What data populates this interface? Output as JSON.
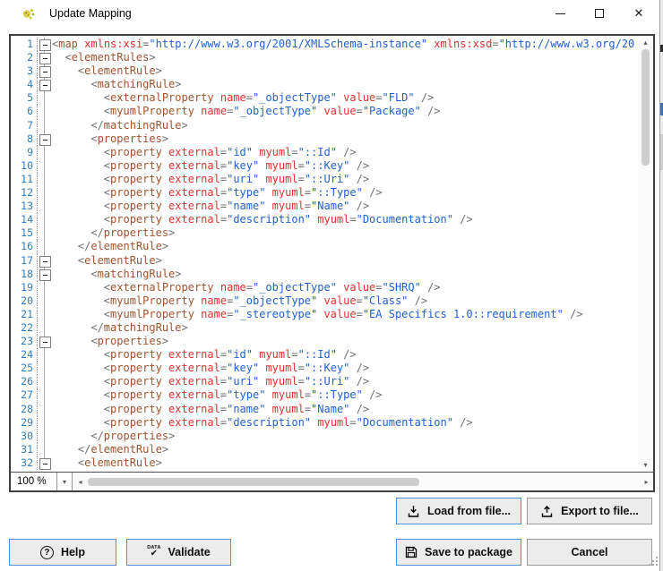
{
  "window": {
    "title": "Update Mapping"
  },
  "icons": {
    "help_glyph": "?",
    "validate_text": "DATA",
    "validate_check": "✔",
    "close_glyph": "✕",
    "dropdown_arrow": "▾",
    "scroll_up": "▴",
    "scroll_down": "▾",
    "scroll_left": "◂",
    "scroll_right": "▸"
  },
  "editor": {
    "zoom_level": "100 %",
    "lines": [
      {
        "n": 1,
        "f": 1,
        "s": [
          [
            "d",
            "<"
          ],
          [
            "t",
            "map"
          ],
          [
            "a",
            " xmlns:xsi"
          ],
          [
            "d",
            "="
          ],
          [
            "v",
            "\"http://www.w3.org/2001/XMLSchema-instance\""
          ],
          [
            "a",
            " xmlns:xsd"
          ],
          [
            "d",
            "="
          ],
          [
            "v",
            "\"http://www.w3.org/20"
          ]
        ]
      },
      {
        "n": 2,
        "f": 1,
        "s": [
          [
            "d",
            "  <"
          ],
          [
            "t",
            "elementRules"
          ],
          [
            "d",
            ">"
          ]
        ]
      },
      {
        "n": 3,
        "f": 1,
        "s": [
          [
            "d",
            "    <"
          ],
          [
            "t",
            "elementRule"
          ],
          [
            "d",
            ">"
          ]
        ]
      },
      {
        "n": 4,
        "f": 1,
        "s": [
          [
            "d",
            "      <"
          ],
          [
            "t",
            "matchingRule"
          ],
          [
            "d",
            ">"
          ]
        ]
      },
      {
        "n": 5,
        "f": 0,
        "s": [
          [
            "d",
            "        <"
          ],
          [
            "t",
            "externalProperty"
          ],
          [
            "a",
            " name"
          ],
          [
            "d",
            "="
          ],
          [
            "v",
            "\"_objectType\""
          ],
          [
            "a",
            " value"
          ],
          [
            "d",
            "="
          ],
          [
            "v",
            "\"FLD\""
          ],
          [
            "d",
            " />"
          ]
        ]
      },
      {
        "n": 6,
        "f": 0,
        "s": [
          [
            "d",
            "        <"
          ],
          [
            "t",
            "myumlProperty"
          ],
          [
            "a",
            " name"
          ],
          [
            "d",
            "="
          ],
          [
            "v",
            "\"_objectType\""
          ],
          [
            "a",
            " value"
          ],
          [
            "d",
            "="
          ],
          [
            "v",
            "\"Package\""
          ],
          [
            "d",
            " />"
          ]
        ]
      },
      {
        "n": 7,
        "f": 0,
        "s": [
          [
            "d",
            "      </"
          ],
          [
            "t",
            "matchingRule"
          ],
          [
            "d",
            ">"
          ]
        ]
      },
      {
        "n": 8,
        "f": 1,
        "s": [
          [
            "d",
            "      <"
          ],
          [
            "t",
            "properties"
          ],
          [
            "d",
            ">"
          ]
        ]
      },
      {
        "n": 9,
        "f": 0,
        "s": [
          [
            "d",
            "        <"
          ],
          [
            "t",
            "property"
          ],
          [
            "a",
            " external"
          ],
          [
            "d",
            "="
          ],
          [
            "v",
            "\"id\""
          ],
          [
            "a",
            " myuml"
          ],
          [
            "d",
            "="
          ],
          [
            "v",
            "\"::Id\""
          ],
          [
            "d",
            " />"
          ]
        ]
      },
      {
        "n": 10,
        "f": 0,
        "s": [
          [
            "d",
            "        <"
          ],
          [
            "t",
            "property"
          ],
          [
            "a",
            " external"
          ],
          [
            "d",
            "="
          ],
          [
            "v",
            "\"key\""
          ],
          [
            "a",
            " myuml"
          ],
          [
            "d",
            "="
          ],
          [
            "v",
            "\"::Key\""
          ],
          [
            "d",
            " />"
          ]
        ]
      },
      {
        "n": 11,
        "f": 0,
        "s": [
          [
            "d",
            "        <"
          ],
          [
            "t",
            "property"
          ],
          [
            "a",
            " external"
          ],
          [
            "d",
            "="
          ],
          [
            "v",
            "\"uri\""
          ],
          [
            "a",
            " myuml"
          ],
          [
            "d",
            "="
          ],
          [
            "v",
            "\"::Uri\""
          ],
          [
            "d",
            " />"
          ]
        ]
      },
      {
        "n": 12,
        "f": 0,
        "s": [
          [
            "d",
            "        <"
          ],
          [
            "t",
            "property"
          ],
          [
            "a",
            " external"
          ],
          [
            "d",
            "="
          ],
          [
            "v",
            "\"type\""
          ],
          [
            "a",
            " myuml"
          ],
          [
            "d",
            "="
          ],
          [
            "v",
            "\"::Type\""
          ],
          [
            "d",
            " />"
          ]
        ]
      },
      {
        "n": 13,
        "f": 0,
        "s": [
          [
            "d",
            "        <"
          ],
          [
            "t",
            "property"
          ],
          [
            "a",
            " external"
          ],
          [
            "d",
            "="
          ],
          [
            "v",
            "\"name\""
          ],
          [
            "a",
            " myuml"
          ],
          [
            "d",
            "="
          ],
          [
            "v",
            "\"Name\""
          ],
          [
            "d",
            " />"
          ]
        ]
      },
      {
        "n": 14,
        "f": 0,
        "s": [
          [
            "d",
            "        <"
          ],
          [
            "t",
            "property"
          ],
          [
            "a",
            " external"
          ],
          [
            "d",
            "="
          ],
          [
            "v",
            "\"description\""
          ],
          [
            "a",
            " myuml"
          ],
          [
            "d",
            "="
          ],
          [
            "v",
            "\"Documentation\""
          ],
          [
            "d",
            " />"
          ]
        ]
      },
      {
        "n": 15,
        "f": 0,
        "s": [
          [
            "d",
            "      </"
          ],
          [
            "t",
            "properties"
          ],
          [
            "d",
            ">"
          ]
        ]
      },
      {
        "n": 16,
        "f": 0,
        "s": [
          [
            "d",
            "    </"
          ],
          [
            "t",
            "elementRule"
          ],
          [
            "d",
            ">"
          ]
        ]
      },
      {
        "n": 17,
        "f": 1,
        "s": [
          [
            "d",
            "    <"
          ],
          [
            "t",
            "elementRule"
          ],
          [
            "d",
            ">"
          ]
        ]
      },
      {
        "n": 18,
        "f": 1,
        "s": [
          [
            "d",
            "      <"
          ],
          [
            "t",
            "matchingRule"
          ],
          [
            "d",
            ">"
          ]
        ]
      },
      {
        "n": 19,
        "f": 0,
        "s": [
          [
            "d",
            "        <"
          ],
          [
            "t",
            "externalProperty"
          ],
          [
            "a",
            " name"
          ],
          [
            "d",
            "="
          ],
          [
            "v",
            "\"_objectType\""
          ],
          [
            "a",
            " value"
          ],
          [
            "d",
            "="
          ],
          [
            "v",
            "\"SHRQ\""
          ],
          [
            "d",
            " />"
          ]
        ]
      },
      {
        "n": 20,
        "f": 0,
        "s": [
          [
            "d",
            "        <"
          ],
          [
            "t",
            "myumlProperty"
          ],
          [
            "a",
            " name"
          ],
          [
            "d",
            "="
          ],
          [
            "v",
            "\"_objectType\""
          ],
          [
            "a",
            " value"
          ],
          [
            "d",
            "="
          ],
          [
            "v",
            "\"Class\""
          ],
          [
            "d",
            " />"
          ]
        ]
      },
      {
        "n": 21,
        "f": 0,
        "s": [
          [
            "d",
            "        <"
          ],
          [
            "t",
            "myumlProperty"
          ],
          [
            "a",
            " name"
          ],
          [
            "d",
            "="
          ],
          [
            "v",
            "\"_stereotype\""
          ],
          [
            "a",
            " value"
          ],
          [
            "d",
            "="
          ],
          [
            "v",
            "\"EA Specifics 1.0::requirement\""
          ],
          [
            "d",
            " />"
          ]
        ]
      },
      {
        "n": 22,
        "f": 0,
        "s": [
          [
            "d",
            "      </"
          ],
          [
            "t",
            "matchingRule"
          ],
          [
            "d",
            ">"
          ]
        ]
      },
      {
        "n": 23,
        "f": 1,
        "s": [
          [
            "d",
            "      <"
          ],
          [
            "t",
            "properties"
          ],
          [
            "d",
            ">"
          ]
        ]
      },
      {
        "n": 24,
        "f": 0,
        "s": [
          [
            "d",
            "        <"
          ],
          [
            "t",
            "property"
          ],
          [
            "a",
            " external"
          ],
          [
            "d",
            "="
          ],
          [
            "v",
            "\"id\""
          ],
          [
            "a",
            " myuml"
          ],
          [
            "d",
            "="
          ],
          [
            "v",
            "\"::Id\""
          ],
          [
            "d",
            " />"
          ]
        ]
      },
      {
        "n": 25,
        "f": 0,
        "s": [
          [
            "d",
            "        <"
          ],
          [
            "t",
            "property"
          ],
          [
            "a",
            " external"
          ],
          [
            "d",
            "="
          ],
          [
            "v",
            "\"key\""
          ],
          [
            "a",
            " myuml"
          ],
          [
            "d",
            "="
          ],
          [
            "v",
            "\"::Key\""
          ],
          [
            "d",
            " />"
          ]
        ]
      },
      {
        "n": 26,
        "f": 0,
        "s": [
          [
            "d",
            "        <"
          ],
          [
            "t",
            "property"
          ],
          [
            "a",
            " external"
          ],
          [
            "d",
            "="
          ],
          [
            "v",
            "\"uri\""
          ],
          [
            "a",
            " myuml"
          ],
          [
            "d",
            "="
          ],
          [
            "v",
            "\"::Uri\""
          ],
          [
            "d",
            " />"
          ]
        ]
      },
      {
        "n": 27,
        "f": 0,
        "s": [
          [
            "d",
            "        <"
          ],
          [
            "t",
            "property"
          ],
          [
            "a",
            " external"
          ],
          [
            "d",
            "="
          ],
          [
            "v",
            "\"type\""
          ],
          [
            "a",
            " myuml"
          ],
          [
            "d",
            "="
          ],
          [
            "v",
            "\"::Type\""
          ],
          [
            "d",
            " />"
          ]
        ]
      },
      {
        "n": 28,
        "f": 0,
        "s": [
          [
            "d",
            "        <"
          ],
          [
            "t",
            "property"
          ],
          [
            "a",
            " external"
          ],
          [
            "d",
            "="
          ],
          [
            "v",
            "\"name\""
          ],
          [
            "a",
            " myuml"
          ],
          [
            "d",
            "="
          ],
          [
            "v",
            "\"Name\""
          ],
          [
            "d",
            " />"
          ]
        ]
      },
      {
        "n": 29,
        "f": 0,
        "s": [
          [
            "d",
            "        <"
          ],
          [
            "t",
            "property"
          ],
          [
            "a",
            " external"
          ],
          [
            "d",
            "="
          ],
          [
            "v",
            "\"description\""
          ],
          [
            "a",
            " myuml"
          ],
          [
            "d",
            "="
          ],
          [
            "v",
            "\"Documentation\""
          ],
          [
            "d",
            " />"
          ]
        ]
      },
      {
        "n": 30,
        "f": 0,
        "s": [
          [
            "d",
            "      </"
          ],
          [
            "t",
            "properties"
          ],
          [
            "d",
            ">"
          ]
        ]
      },
      {
        "n": 31,
        "f": 0,
        "s": [
          [
            "d",
            "    </"
          ],
          [
            "t",
            "elementRule"
          ],
          [
            "d",
            ">"
          ]
        ]
      },
      {
        "n": 32,
        "f": 1,
        "s": [
          [
            "d",
            "    <"
          ],
          [
            "t",
            "elementRule"
          ],
          [
            "d",
            ">"
          ]
        ]
      }
    ]
  },
  "buttons": {
    "load_label": "Load from file...",
    "export_label": "Export to file...",
    "help_label": "Help",
    "validate_label": "Validate",
    "save_label": "Save to package",
    "cancel_label": "Cancel"
  },
  "colors": {
    "accent_border": "#4a90d9",
    "tag": "#a0522d",
    "attribute": "#e03131",
    "value": "#2060d0",
    "delimiter": "#6f6f6f",
    "line_number": "#2e7ec1"
  }
}
